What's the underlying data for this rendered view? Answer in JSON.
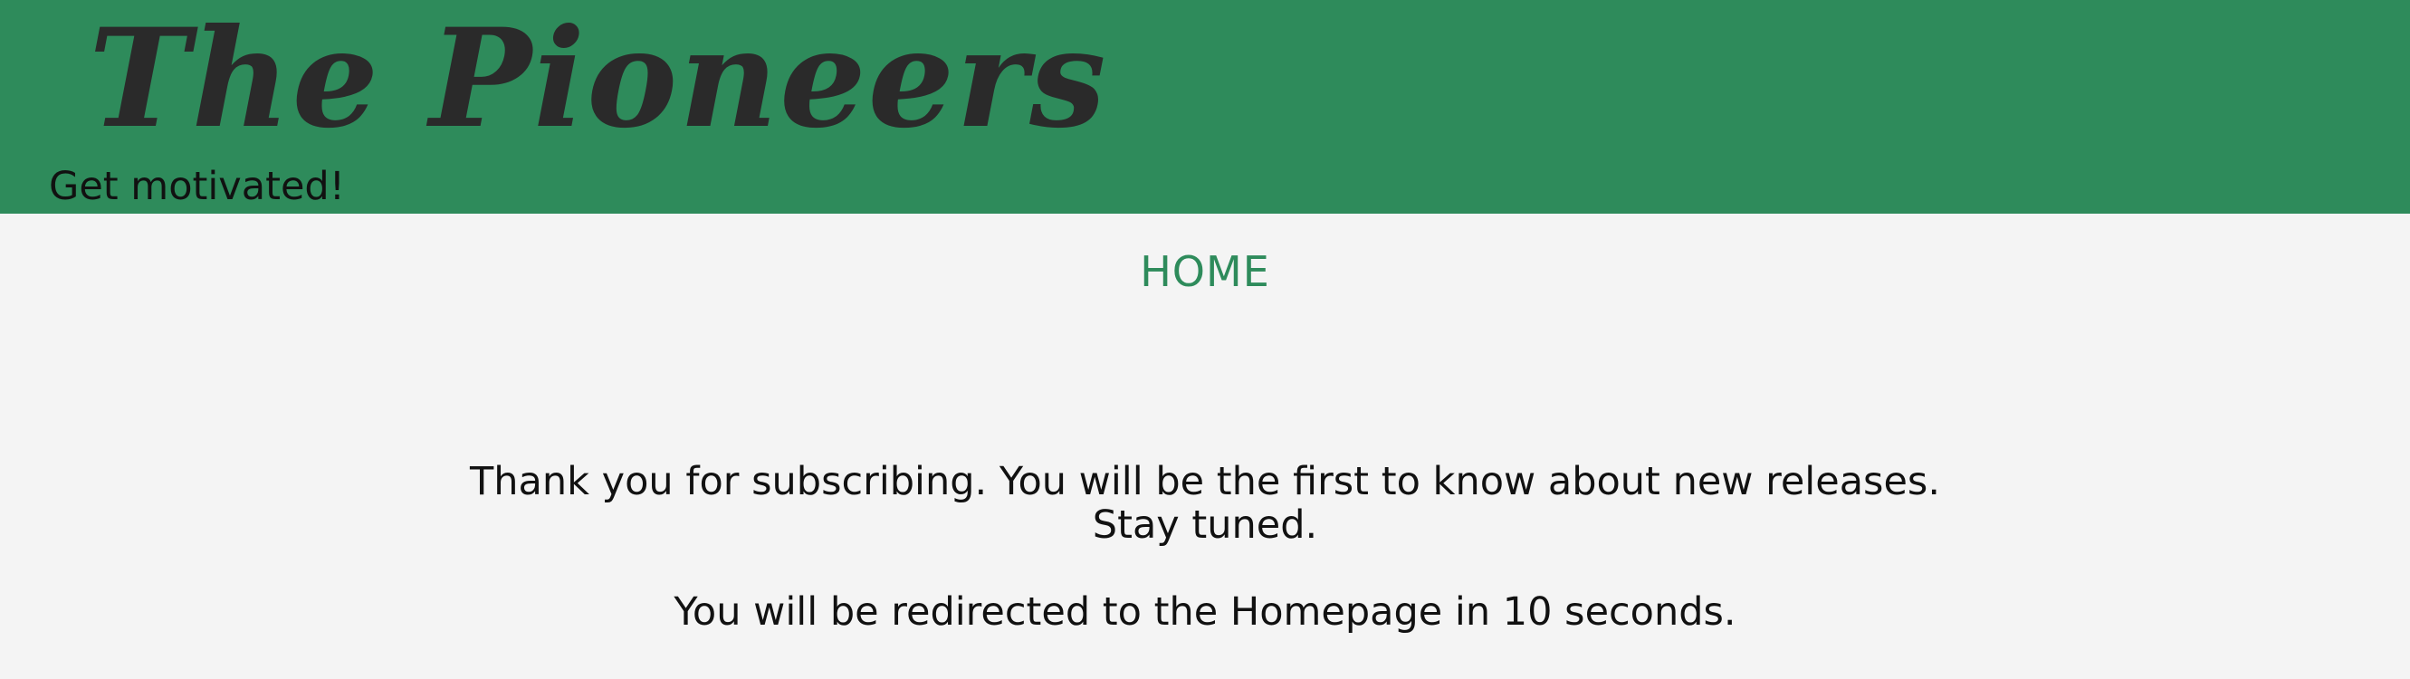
{
  "header": {
    "title": "The Pioneers",
    "tagline": "Get motivated!"
  },
  "nav": {
    "home_label": "HOME"
  },
  "main": {
    "line1": "Thank you for subscribing. You will be the first to know about new releases.",
    "line2": "Stay tuned.",
    "line3": "You will be redirected to the Homepage in 10 seconds."
  },
  "colors": {
    "header_bg": "#2e8b5b",
    "page_bg": "#f4f4f4",
    "accent": "#2e8b5b",
    "title_text": "#2a2a2a"
  }
}
